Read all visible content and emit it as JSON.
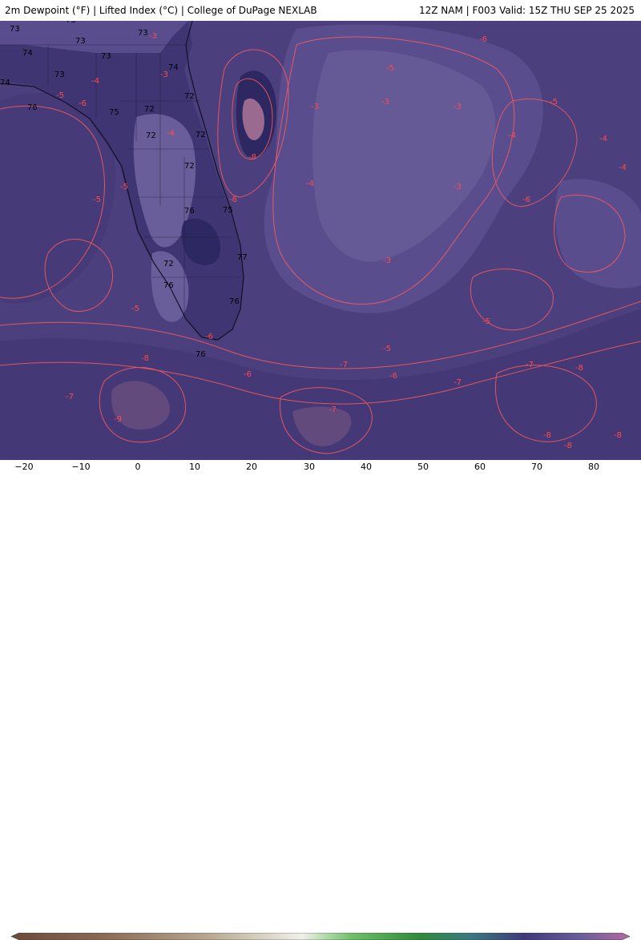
{
  "header": {
    "left_title": "2m Dewpoint (°F) | Lifted Index (°C) | College of DuPage NEXLAB",
    "right_title": "12Z NAM | F003 Valid: 15Z THU SEP 25 2025"
  },
  "colorbar": {
    "ticks": [
      "−20",
      "−10",
      "0",
      "10",
      "20",
      "30",
      "40",
      "50",
      "60",
      "70",
      "80"
    ]
  },
  "colors": {
    "background": "#4b3f7e",
    "land_dark": "#3f3572",
    "land_light": "#6a5e9a",
    "pink_area": "#9a6a8f",
    "contour": "#ff5a5a"
  },
  "dewpoint_labels": [
    "73",
    "73",
    "73",
    "74",
    "73",
    "73",
    "73",
    "74",
    "76",
    "75",
    "72",
    "72",
    "72",
    "72",
    "74",
    "76",
    "75",
    "77",
    "72",
    "72",
    "76",
    "76",
    "76"
  ],
  "lifted_index_labels": [
    "-3",
    "-4",
    "-5",
    "-6",
    "-3",
    "-5",
    "-4",
    "-5",
    "-3",
    "-3",
    "-4",
    "-8",
    "-6",
    "-4",
    "-3",
    "-4",
    "-6",
    "-5",
    "-3",
    "-6",
    "-7",
    "-5",
    "-5",
    "-6",
    "-8",
    "-6",
    "-5",
    "-7",
    "-7",
    "-8",
    "-9",
    "-8",
    "-8",
    "-7",
    "-8",
    "-4",
    "-5",
    "-3",
    "-6",
    "-7"
  ]
}
